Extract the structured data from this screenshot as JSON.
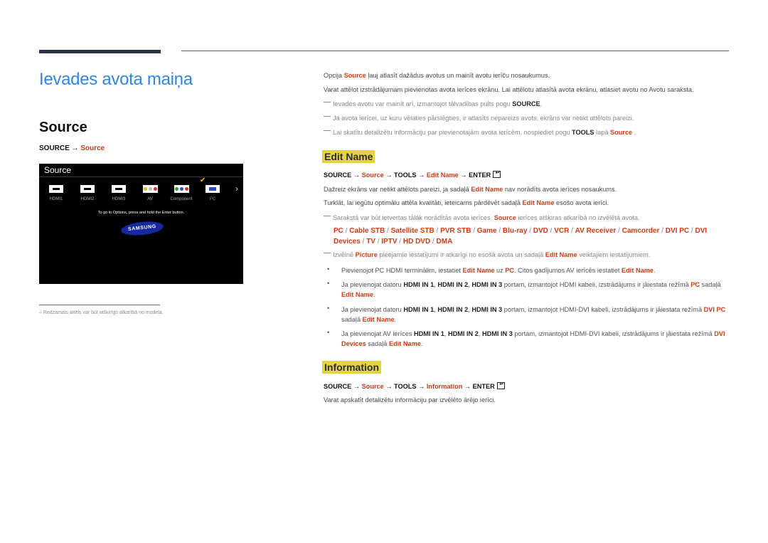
{
  "header": {
    "title": "Ievades avota maiņa"
  },
  "left": {
    "section_title": "Source",
    "path": {
      "a": "SOURCE →",
      "b": "Source"
    },
    "screen": {
      "title": "Source",
      "sources": [
        {
          "label": "HDMI1",
          "icon": "hdmi-port-icon",
          "selected": false
        },
        {
          "label": "HDMI2",
          "icon": "hdmi-port-icon",
          "selected": false
        },
        {
          "label": "HDMI3",
          "icon": "hdmi-port-icon",
          "selected": false
        },
        {
          "label": "AV",
          "icon": "av-port-icon",
          "selected": false
        },
        {
          "label": "Component",
          "icon": "component-port-icon",
          "selected": false
        },
        {
          "label": "PC",
          "icon": "pc-port-icon",
          "selected": true
        }
      ],
      "hint": "To go to Options, press and hold the Enter button.",
      "logo": "SAMSUNG"
    },
    "footnote": "Redzamais attēls var būt atšķirīgs atkarībā no modeļa."
  },
  "right": {
    "intro1": {
      "a": "Opcija ",
      "b": "Source",
      "c": " ļauj atlasīt dažādus avotus un mainīt avotu ierīču nosaukumus."
    },
    "intro2": "Varat attēlot izstrādājumam pievienotas avota ierīces ekrānu. Lai attēlotu atlasītā avota ekrānu, atlasiet avotu no Avotu saraksta.",
    "note1": {
      "a": "Ievades avotu var mainīt arī, izmantojot tālvadības pults pogu ",
      "b": "SOURCE",
      "c": "."
    },
    "note2": "Ja avota ierīcei, uz kuru vēlaties pārslēgties, ir atlasīts nepareizs avots, ekrāns var netikt attēlots pareizi.",
    "note3": {
      "a": "Lai skatītu detalizētu informāciju par pievienotajām avota ierīcēm, nospiediet pogu ",
      "b": "TOOLS",
      "c": " lapā ",
      "d": "Source",
      "e": " ."
    },
    "edit_name": {
      "heading": "Edit Name",
      "path": {
        "p1": "SOURCE → ",
        "p2": "Source",
        "p3": " → TOOLS → ",
        "p4": "Edit Name",
        "p5": " → ENTER"
      },
      "text1": {
        "a": "Dažreiz ekrāns var netikt attēlots pareizi, ja sadaļā ",
        "b": "Edit Name",
        "c": " nav norādīts avota ierīces nosaukums."
      },
      "text2": {
        "a": "Turklāt, lai iegūtu optimālu attēla kvalitāti, ieteicams pārdēvēt sadaļā ",
        "b": "Edit Name",
        "c": " esošo avota ierīci."
      },
      "note1": {
        "a": "Sarakstā var būt ietvertas tālāk norādītās avota ierīces. ",
        "b": "Source",
        "c": " ierīces atšķiras atkarībā no izvēlētā avota."
      },
      "devices": [
        "PC",
        "Cable STB",
        "Satellite STB",
        "PVR STB",
        "Game",
        "Blu-ray",
        "DVD",
        "VCR",
        "AV Receiver",
        "Camcorder",
        "DVI PC",
        "DVI Devices",
        "TV",
        "IPTV",
        "HD DVD",
        "DMA"
      ],
      "note2": {
        "a": "Izvēlnē ",
        "b": "Picture",
        "c": " pieejamie iestatījumi ir atkarīgi no esošā avota un sadaļā ",
        "d": "Edit Name",
        "e": " veiktajiem iestatījumiem."
      },
      "bullets": [
        {
          "a": "Pievienojot PC HDMI terminālim, iestatiet ",
          "b": "Edit Name",
          "c": " uz ",
          "d": "PC",
          "e": ". Citos gadījumos AV ierīcēs iestatiet ",
          "f": "Edit Name",
          "g": "."
        },
        {
          "a": "Ja pievienojat datoru ",
          "b": "HDMI IN 1",
          "c": ", ",
          "d": "HDMI IN 2",
          "e": ", ",
          "f": "HDMI IN 3",
          "g": " portam, izmantojot HDMI kabeli, izstrādājums ir jāiestata režīmā ",
          "h": "PC",
          "i": " sadaļā ",
          "j": "Edit Name",
          "k": "."
        },
        {
          "a": "Ja pievienojat datoru ",
          "b": "HDMI IN 1",
          "c": ", ",
          "d": "HDMI IN 2",
          "e": ", ",
          "f": "HDMI IN 3",
          "g": " portam, izmantojot HDMI-DVI kabeli, izstrādājums ir jāiestata režīmā ",
          "h": "DVI PC",
          "i": " sadaļā ",
          "j": "Edit Name",
          "k": "."
        },
        {
          "a": "Ja pievienojat AV ierīces ",
          "b": "HDMI IN 1",
          "c": ", ",
          "d": "HDMI IN 2",
          "e": ", ",
          "f": "HDMI IN 3",
          "g": " portam, izmantojot HDMI-DVI kabeli, izstrādājums ir jāiestata režīmā ",
          "h": "DVI Devices",
          "i": " sadaļā ",
          "j": "Edit Name",
          "k": "."
        }
      ]
    },
    "information": {
      "heading": "Information",
      "path": {
        "p1": "SOURCE → ",
        "p2": "Source",
        "p3": " → TOOLS → ",
        "p4": "Information",
        "p5": " → ENTER"
      },
      "text": "Varat apskatīt detalizētu informāciju par izvēlēto ārējo ierīci."
    }
  }
}
